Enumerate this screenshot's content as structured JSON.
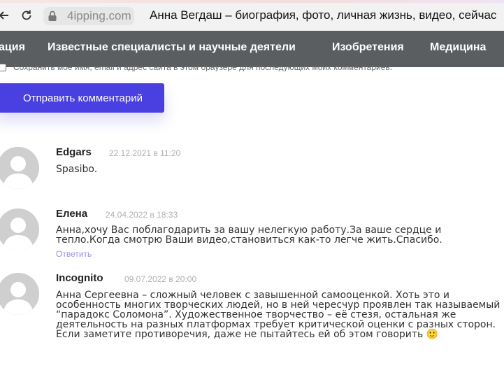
{
  "browser": {
    "domain": "4ipping.com",
    "tab_title": "Анна Вегдаш – биография, фото, личная жизнь, видео, сейчас"
  },
  "nav": {
    "items": [
      "ация",
      "Известные специалисты и научные деятели",
      "Изобретения",
      "Медицина"
    ]
  },
  "form": {
    "consent_text": "Сохранить моё имя, email и адрес сайта в этом браузере для последующих моих комментариев.",
    "submit_label": "Отправить комментарий"
  },
  "comments": [
    {
      "author": "Edgars",
      "date": "22.12.2021 в 11:20",
      "text": "Spasibo.",
      "reply": ""
    },
    {
      "author": "Елена",
      "date": "24.04.2022 в 18:33",
      "text": "Анна,хочу Вас поблагодарить за вашу нелегкую работу.За ваше сердце и тепло.Когда смотрю Ваши видео,становиться как-то легче жить.Спасибо.",
      "reply": "Ответить"
    },
    {
      "author": "Incognito",
      "date": "09.07.2022 в 20:00",
      "text": "Анна Сергеевна – сложный человек с завышенной самооценкой. Хоть это и особенность многих творческих людей, но в ней чересчур проявлен так называемый “парадокс Соломона”. Художественное творчество – её стезя, остальная же деятельность на разных платформах требует критической оценки с разных сторон. Если заметите противоречия, даже не пытайтесь ей об этом говорить 🙂",
      "reply": ""
    }
  ]
}
